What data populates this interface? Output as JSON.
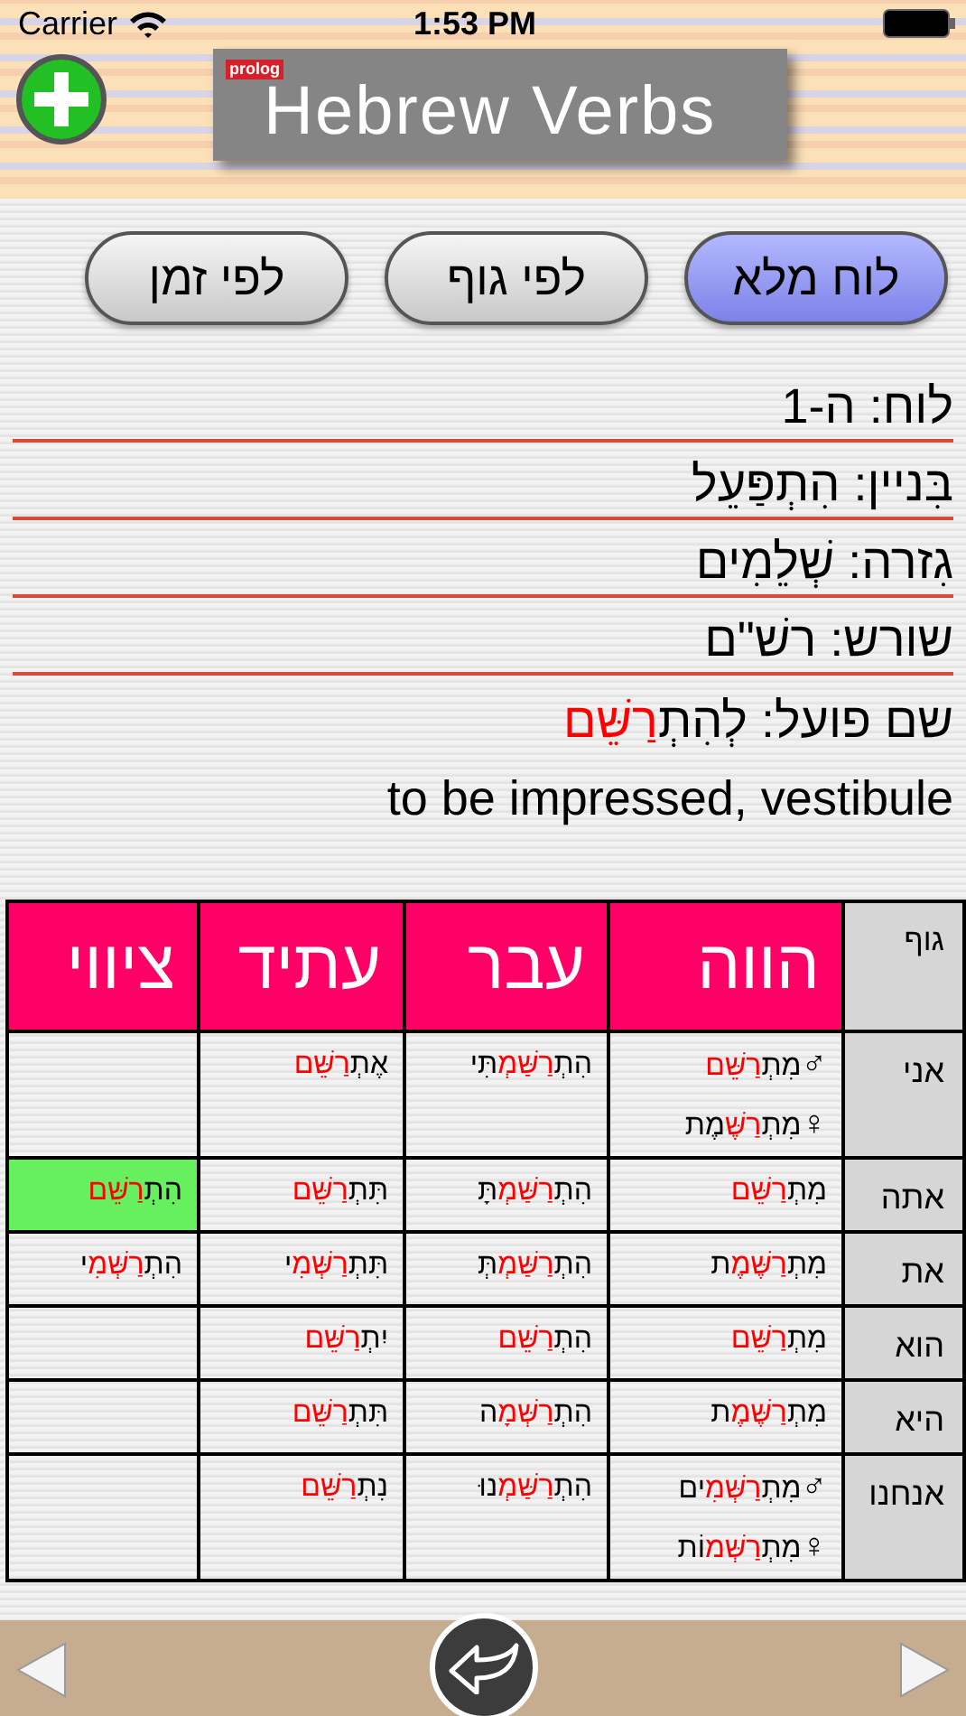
{
  "status_bar": {
    "carrier": "Carrier",
    "time": "1:53 PM"
  },
  "header": {
    "logo": "prolog",
    "title": "Hebrew Verbs"
  },
  "view_buttons": [
    {
      "label": "לוח מלא",
      "selected": true
    },
    {
      "label": "לפי גוף",
      "selected": false
    },
    {
      "label": "לפי זמן",
      "selected": false
    }
  ],
  "info_lines": [
    {
      "parts": [
        {
          "text": "לוח: ה-1",
          "red": false
        }
      ]
    },
    {
      "parts": [
        {
          "text": "בִּניין: הִתְפַּעֵל",
          "red": false
        }
      ]
    },
    {
      "parts": [
        {
          "text": "גִזרה: שְׁלֵמִים",
          "red": false
        }
      ]
    },
    {
      "parts": [
        {
          "text": "שורש: רשׁ\"ם",
          "red": false
        }
      ]
    },
    {
      "parts": [
        {
          "text": "שם פועל: לְהִתְ",
          "red": false
        },
        {
          "text": "רַשֵּׁם",
          "red": true
        }
      ]
    }
  ],
  "translation": "to be impressed, vestibule",
  "table": {
    "corner": "גוף",
    "columns": [
      "הווה",
      "עבר",
      "עתיד",
      "ציווי"
    ],
    "rows": [
      {
        "person": "אני",
        "cells": [
          {
            "highlighted": false,
            "forms": [
              {
                "symbol": "♂",
                "parts": [
                  {
                    "text": "מִתְ",
                    "red": false
                  },
                  {
                    "text": "רַשֵּׁם",
                    "red": true
                  }
                ]
              },
              {
                "symbol": "♀",
                "parts": [
                  {
                    "text": "מִתְ",
                    "red": false
                  },
                  {
                    "text": "רַשֶּׁ",
                    "red": true
                  },
                  {
                    "text": "מֶת",
                    "red": false
                  }
                ]
              }
            ]
          },
          {
            "highlighted": false,
            "forms": [
              {
                "parts": [
                  {
                    "text": "הִתְ",
                    "red": false
                  },
                  {
                    "text": "רַשַּׁמְ",
                    "red": true
                  },
                  {
                    "text": "תִּי",
                    "red": false
                  }
                ]
              }
            ]
          },
          {
            "highlighted": false,
            "forms": [
              {
                "parts": [
                  {
                    "text": "אֶתְ",
                    "red": false
                  },
                  {
                    "text": "רַשֵּׁם",
                    "red": true
                  }
                ]
              }
            ]
          },
          {
            "highlighted": false
          }
        ]
      },
      {
        "person": "אתה",
        "cells": [
          {
            "highlighted": false,
            "forms": [
              {
                "parts": [
                  {
                    "text": "מִתְ",
                    "red": false
                  },
                  {
                    "text": "רַשֵּׁם",
                    "red": true
                  }
                ]
              }
            ]
          },
          {
            "highlighted": false,
            "forms": [
              {
                "parts": [
                  {
                    "text": "הִתְ",
                    "red": false
                  },
                  {
                    "text": "רַשַּׁמְ",
                    "red": true
                  },
                  {
                    "text": "תָּ",
                    "red": false
                  }
                ]
              }
            ]
          },
          {
            "highlighted": false,
            "forms": [
              {
                "parts": [
                  {
                    "text": "תִּתְ",
                    "red": false
                  },
                  {
                    "text": "רַשֵּׁם",
                    "red": true
                  }
                ]
              }
            ]
          },
          {
            "highlighted": true,
            "forms": [
              {
                "parts": [
                  {
                    "text": "הִתְ",
                    "red": false
                  },
                  {
                    "text": "רַשֵּׁם",
                    "red": true
                  }
                ]
              }
            ]
          }
        ]
      },
      {
        "person": "את",
        "cells": [
          {
            "highlighted": false,
            "forms": [
              {
                "parts": [
                  {
                    "text": "מִתְ",
                    "red": false
                  },
                  {
                    "text": "רַשֶּׁמֶ",
                    "red": true
                  },
                  {
                    "text": "ת",
                    "red": false
                  }
                ]
              }
            ]
          },
          {
            "highlighted": false,
            "forms": [
              {
                "parts": [
                  {
                    "text": "הִתְ",
                    "red": false
                  },
                  {
                    "text": "רַשַּׁמְ",
                    "red": true
                  },
                  {
                    "text": "תְּ",
                    "red": false
                  }
                ]
              }
            ]
          },
          {
            "highlighted": false,
            "forms": [
              {
                "parts": [
                  {
                    "text": "תִּתְ",
                    "red": false
                  },
                  {
                    "text": "רַשְּׁמִ",
                    "red": true
                  },
                  {
                    "text": "י",
                    "red": false
                  }
                ]
              }
            ]
          },
          {
            "highlighted": false,
            "forms": [
              {
                "parts": [
                  {
                    "text": "הִתְ",
                    "red": false
                  },
                  {
                    "text": "רַשְּׁמִ",
                    "red": true
                  },
                  {
                    "text": "י",
                    "red": false
                  }
                ]
              }
            ]
          }
        ]
      },
      {
        "person": "הוא",
        "cells": [
          {
            "highlighted": false,
            "forms": [
              {
                "parts": [
                  {
                    "text": "מִתְ",
                    "red": false
                  },
                  {
                    "text": "רַשֵּׁם",
                    "red": true
                  }
                ]
              }
            ]
          },
          {
            "highlighted": false,
            "forms": [
              {
                "parts": [
                  {
                    "text": "הִתְ",
                    "red": false
                  },
                  {
                    "text": "רַשֵּׁם",
                    "red": true
                  }
                ]
              }
            ]
          },
          {
            "highlighted": false,
            "forms": [
              {
                "parts": [
                  {
                    "text": "יִתְ",
                    "red": false
                  },
                  {
                    "text": "רַשֵּׁם",
                    "red": true
                  }
                ]
              }
            ]
          },
          {
            "highlighted": false
          }
        ]
      },
      {
        "person": "היא",
        "cells": [
          {
            "highlighted": false,
            "forms": [
              {
                "parts": [
                  {
                    "text": "מִתְ",
                    "red": false
                  },
                  {
                    "text": "רַשֶּׁמֶ",
                    "red": true
                  },
                  {
                    "text": "ת",
                    "red": false
                  }
                ]
              }
            ]
          },
          {
            "highlighted": false,
            "forms": [
              {
                "parts": [
                  {
                    "text": "הִתְ",
                    "red": false
                  },
                  {
                    "text": "רַשְּׁמָ",
                    "red": true
                  },
                  {
                    "text": "ה",
                    "red": false
                  }
                ]
              }
            ]
          },
          {
            "highlighted": false,
            "forms": [
              {
                "parts": [
                  {
                    "text": "תִּתְ",
                    "red": false
                  },
                  {
                    "text": "רַשֵּׁם",
                    "red": true
                  }
                ]
              }
            ]
          },
          {
            "highlighted": false
          }
        ]
      },
      {
        "person": "אנחנו",
        "cells": [
          {
            "highlighted": false,
            "forms": [
              {
                "symbol": "♂",
                "parts": [
                  {
                    "text": "מִתְ",
                    "red": false
                  },
                  {
                    "text": "רַשְּׁמִ",
                    "red": true
                  },
                  {
                    "text": "ים",
                    "red": false
                  }
                ]
              },
              {
                "symbol": "♀",
                "parts": [
                  {
                    "text": "מִתְ",
                    "red": false
                  },
                  {
                    "text": "רַשְּׁמ",
                    "red": true
                  },
                  {
                    "text": "וֹת",
                    "red": false
                  }
                ]
              }
            ]
          },
          {
            "highlighted": false,
            "forms": [
              {
                "parts": [
                  {
                    "text": "הִתְ",
                    "red": false
                  },
                  {
                    "text": "רַשַּׁמְ",
                    "red": true
                  },
                  {
                    "text": "נוּ",
                    "red": false
                  }
                ]
              }
            ]
          },
          {
            "highlighted": false,
            "forms": [
              {
                "parts": [
                  {
                    "text": "נִתְ",
                    "red": false
                  },
                  {
                    "text": "רַשֵּׁם",
                    "red": true
                  }
                ]
              }
            ]
          },
          {
            "highlighted": false
          }
        ]
      }
    ]
  }
}
